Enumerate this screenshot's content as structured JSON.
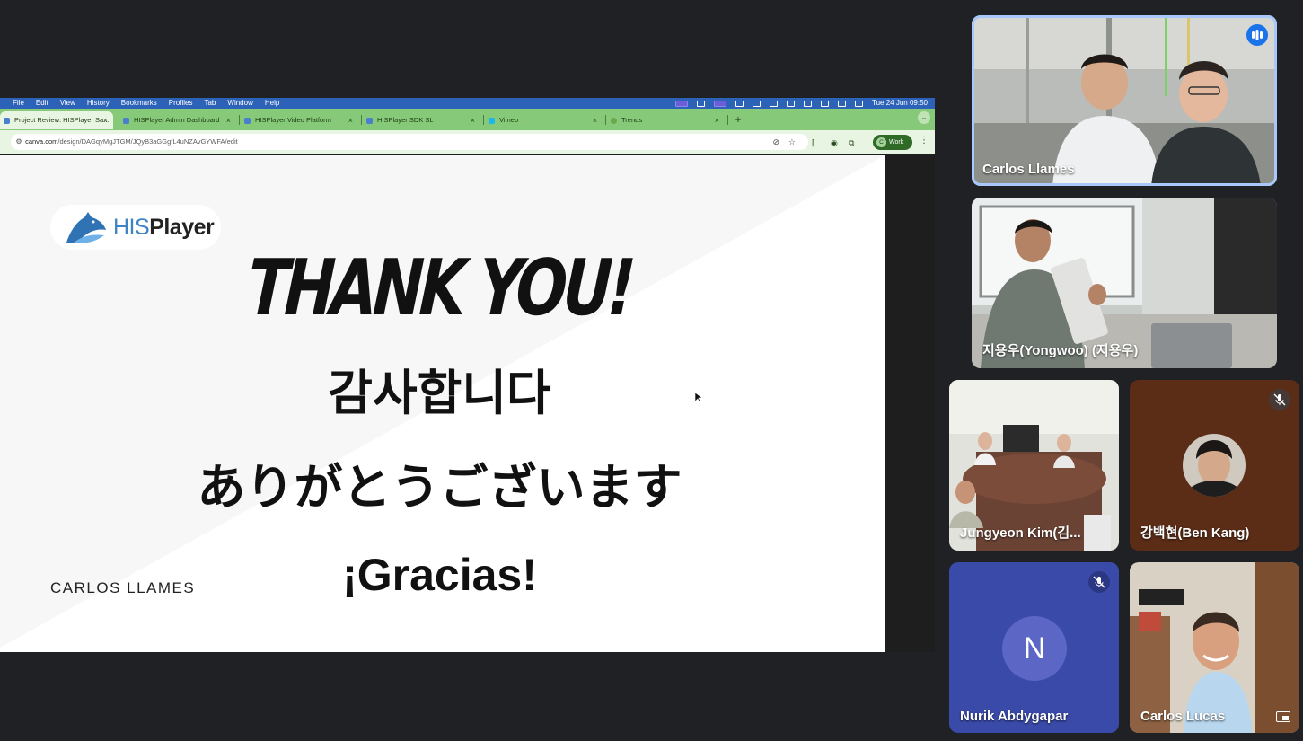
{
  "menubar": {
    "items": [
      "",
      "File",
      "Edit",
      "View",
      "History",
      "Bookmarks",
      "Profiles",
      "Tab",
      "Window",
      "Help"
    ],
    "clock": "Tue 24 Jun  09:50"
  },
  "tabs": [
    {
      "title": "Project Review: HISPlayer Sa..."
    },
    {
      "title": "HISPlayer Admin Dashboard"
    },
    {
      "title": "HISPlayer Video Platform"
    },
    {
      "title": "HISPlayer SDK SL"
    },
    {
      "title": "Vimeo"
    },
    {
      "title": "Trends"
    }
  ],
  "address": {
    "domain": "canva.com",
    "path": "/design/DAGqyMgJTGM/JQyB3aGGgfL4uNZAvGYWFA/edit"
  },
  "profile": {
    "initial": "C",
    "label": "Work"
  },
  "slide": {
    "logo_his": "HIS",
    "logo_player": "Player",
    "thanks_en": "THANK YOU!",
    "thanks_ko": "감사합니다",
    "thanks_ja": "ありがとうございます",
    "thanks_es": "¡Gracias!",
    "presenter": "CARLOS LLAMES"
  },
  "participants": [
    {
      "name": "Carlos Llames",
      "state": "speaking"
    },
    {
      "name": "지용우(Yongwoo) (지용우)",
      "state": "normal"
    },
    {
      "name": "Jungyeon Kim(김...",
      "state": "normal"
    },
    {
      "name": "강백현(Ben Kang)",
      "state": "muted"
    },
    {
      "name": "Nurik Abdygapar",
      "state": "muted",
      "avatar_initial": "N"
    },
    {
      "name": "Carlos Lucas",
      "state": "normal"
    }
  ],
  "colors": {
    "page_bg": "#202124",
    "tab_bar": "#85c979",
    "speaking_ring": "#a8c7fa",
    "brand_blue": "#3e83c4"
  }
}
